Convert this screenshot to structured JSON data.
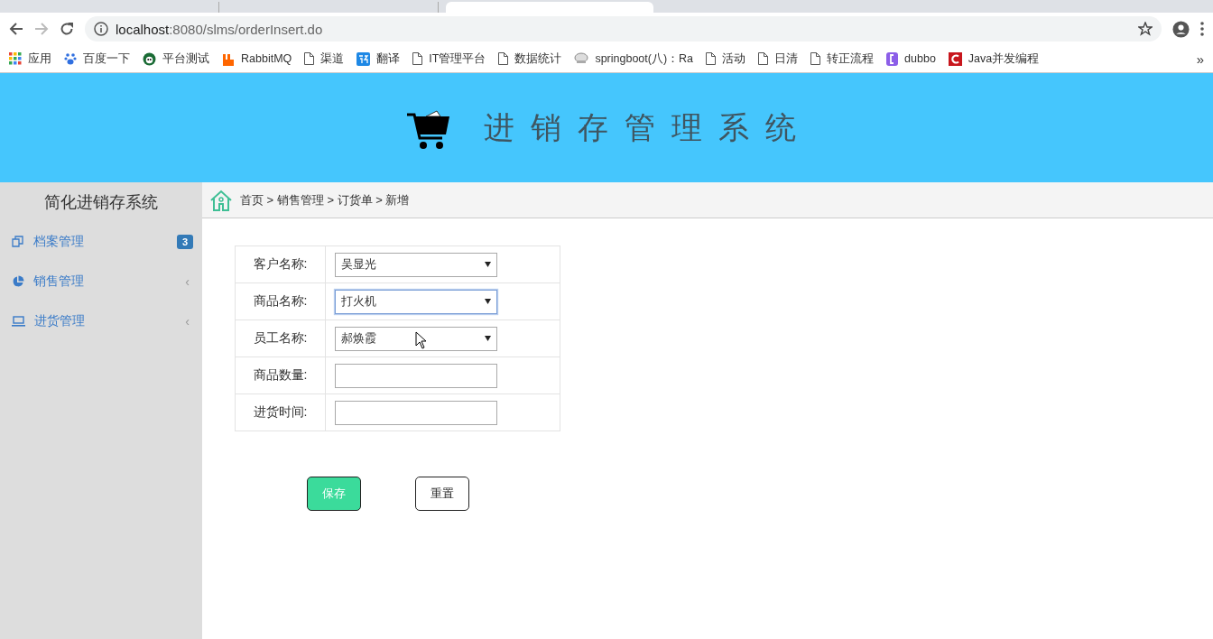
{
  "browser": {
    "tabs": [
      {
        "selected": false
      },
      {
        "selected": false
      },
      {
        "selected": true
      }
    ],
    "url_host": "localhost",
    "url_path": ":8080/slms/orderInsert.do",
    "bookmarks": [
      {
        "kind": "apps",
        "label": "应用"
      },
      {
        "kind": "paw",
        "label": "百度一下"
      },
      {
        "kind": "globe",
        "label": "平台测试"
      },
      {
        "kind": "rabbit",
        "label": "RabbitMQ"
      },
      {
        "kind": "page",
        "label": "渠道"
      },
      {
        "kind": "translate",
        "label": "翻译"
      },
      {
        "kind": "page",
        "label": "IT管理平台"
      },
      {
        "kind": "page",
        "label": "数据统计"
      },
      {
        "kind": "mask",
        "label": "springboot(八)：Ra"
      },
      {
        "kind": "page",
        "label": "活动"
      },
      {
        "kind": "page",
        "label": "日清"
      },
      {
        "kind": "page",
        "label": "转正流程"
      },
      {
        "kind": "bracket",
        "label": "dubbo"
      },
      {
        "kind": "java",
        "label": "Java并发编程"
      }
    ],
    "more": "»"
  },
  "header": {
    "title": "进销存管理系统"
  },
  "sidebar": {
    "title": "简化进销存系统",
    "items": [
      {
        "kind": "copy",
        "label": "档案管理",
        "badge": "3"
      },
      {
        "kind": "pie",
        "label": "销售管理",
        "arrow": "‹"
      },
      {
        "kind": "laptop",
        "label": "进货管理",
        "arrow": "‹"
      }
    ]
  },
  "breadcrumb": "首页 > 销售管理 > 订货单 > 新增",
  "form": {
    "rows": [
      {
        "label": "客户名称:",
        "kind": "select",
        "value": "吴显光",
        "focused": false
      },
      {
        "label": "商品名称:",
        "kind": "select",
        "value": "打火机",
        "focused": true
      },
      {
        "label": "员工名称:",
        "kind": "select",
        "value": "郝焕霞",
        "focused": false
      },
      {
        "label": "商品数量:",
        "kind": "text",
        "focused": false
      },
      {
        "label": "进货时间:",
        "kind": "text",
        "focused": false
      }
    ],
    "buttons": [
      {
        "kind": "primary",
        "label": "保存"
      },
      {
        "kind": "default",
        "label": "重置"
      }
    ]
  }
}
